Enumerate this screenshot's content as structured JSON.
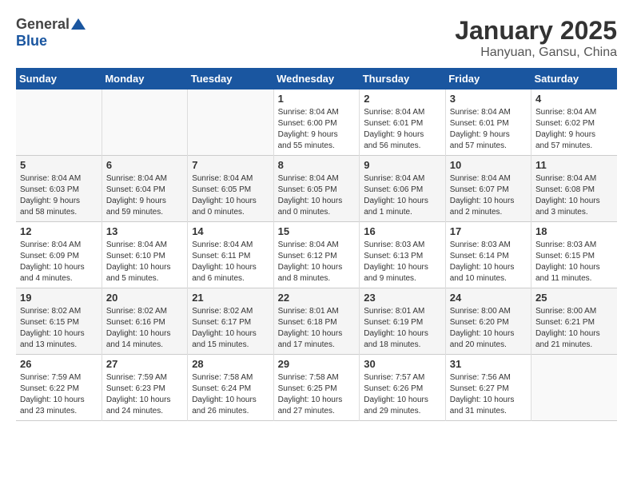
{
  "header": {
    "logo_general": "General",
    "logo_blue": "Blue",
    "title": "January 2025",
    "subtitle": "Hanyuan, Gansu, China"
  },
  "weekdays": [
    "Sunday",
    "Monday",
    "Tuesday",
    "Wednesday",
    "Thursday",
    "Friday",
    "Saturday"
  ],
  "weeks": [
    [
      {
        "day": "",
        "info": ""
      },
      {
        "day": "",
        "info": ""
      },
      {
        "day": "",
        "info": ""
      },
      {
        "day": "1",
        "info": "Sunrise: 8:04 AM\nSunset: 6:00 PM\nDaylight: 9 hours\nand 55 minutes."
      },
      {
        "day": "2",
        "info": "Sunrise: 8:04 AM\nSunset: 6:01 PM\nDaylight: 9 hours\nand 56 minutes."
      },
      {
        "day": "3",
        "info": "Sunrise: 8:04 AM\nSunset: 6:01 PM\nDaylight: 9 hours\nand 57 minutes."
      },
      {
        "day": "4",
        "info": "Sunrise: 8:04 AM\nSunset: 6:02 PM\nDaylight: 9 hours\nand 57 minutes."
      }
    ],
    [
      {
        "day": "5",
        "info": "Sunrise: 8:04 AM\nSunset: 6:03 PM\nDaylight: 9 hours\nand 58 minutes."
      },
      {
        "day": "6",
        "info": "Sunrise: 8:04 AM\nSunset: 6:04 PM\nDaylight: 9 hours\nand 59 minutes."
      },
      {
        "day": "7",
        "info": "Sunrise: 8:04 AM\nSunset: 6:05 PM\nDaylight: 10 hours\nand 0 minutes."
      },
      {
        "day": "8",
        "info": "Sunrise: 8:04 AM\nSunset: 6:05 PM\nDaylight: 10 hours\nand 0 minutes."
      },
      {
        "day": "9",
        "info": "Sunrise: 8:04 AM\nSunset: 6:06 PM\nDaylight: 10 hours\nand 1 minute."
      },
      {
        "day": "10",
        "info": "Sunrise: 8:04 AM\nSunset: 6:07 PM\nDaylight: 10 hours\nand 2 minutes."
      },
      {
        "day": "11",
        "info": "Sunrise: 8:04 AM\nSunset: 6:08 PM\nDaylight: 10 hours\nand 3 minutes."
      }
    ],
    [
      {
        "day": "12",
        "info": "Sunrise: 8:04 AM\nSunset: 6:09 PM\nDaylight: 10 hours\nand 4 minutes."
      },
      {
        "day": "13",
        "info": "Sunrise: 8:04 AM\nSunset: 6:10 PM\nDaylight: 10 hours\nand 5 minutes."
      },
      {
        "day": "14",
        "info": "Sunrise: 8:04 AM\nSunset: 6:11 PM\nDaylight: 10 hours\nand 6 minutes."
      },
      {
        "day": "15",
        "info": "Sunrise: 8:04 AM\nSunset: 6:12 PM\nDaylight: 10 hours\nand 8 minutes."
      },
      {
        "day": "16",
        "info": "Sunrise: 8:03 AM\nSunset: 6:13 PM\nDaylight: 10 hours\nand 9 minutes."
      },
      {
        "day": "17",
        "info": "Sunrise: 8:03 AM\nSunset: 6:14 PM\nDaylight: 10 hours\nand 10 minutes."
      },
      {
        "day": "18",
        "info": "Sunrise: 8:03 AM\nSunset: 6:15 PM\nDaylight: 10 hours\nand 11 minutes."
      }
    ],
    [
      {
        "day": "19",
        "info": "Sunrise: 8:02 AM\nSunset: 6:15 PM\nDaylight: 10 hours\nand 13 minutes."
      },
      {
        "day": "20",
        "info": "Sunrise: 8:02 AM\nSunset: 6:16 PM\nDaylight: 10 hours\nand 14 minutes."
      },
      {
        "day": "21",
        "info": "Sunrise: 8:02 AM\nSunset: 6:17 PM\nDaylight: 10 hours\nand 15 minutes."
      },
      {
        "day": "22",
        "info": "Sunrise: 8:01 AM\nSunset: 6:18 PM\nDaylight: 10 hours\nand 17 minutes."
      },
      {
        "day": "23",
        "info": "Sunrise: 8:01 AM\nSunset: 6:19 PM\nDaylight: 10 hours\nand 18 minutes."
      },
      {
        "day": "24",
        "info": "Sunrise: 8:00 AM\nSunset: 6:20 PM\nDaylight: 10 hours\nand 20 minutes."
      },
      {
        "day": "25",
        "info": "Sunrise: 8:00 AM\nSunset: 6:21 PM\nDaylight: 10 hours\nand 21 minutes."
      }
    ],
    [
      {
        "day": "26",
        "info": "Sunrise: 7:59 AM\nSunset: 6:22 PM\nDaylight: 10 hours\nand 23 minutes."
      },
      {
        "day": "27",
        "info": "Sunrise: 7:59 AM\nSunset: 6:23 PM\nDaylight: 10 hours\nand 24 minutes."
      },
      {
        "day": "28",
        "info": "Sunrise: 7:58 AM\nSunset: 6:24 PM\nDaylight: 10 hours\nand 26 minutes."
      },
      {
        "day": "29",
        "info": "Sunrise: 7:58 AM\nSunset: 6:25 PM\nDaylight: 10 hours\nand 27 minutes."
      },
      {
        "day": "30",
        "info": "Sunrise: 7:57 AM\nSunset: 6:26 PM\nDaylight: 10 hours\nand 29 minutes."
      },
      {
        "day": "31",
        "info": "Sunrise: 7:56 AM\nSunset: 6:27 PM\nDaylight: 10 hours\nand 31 minutes."
      },
      {
        "day": "",
        "info": ""
      }
    ]
  ]
}
